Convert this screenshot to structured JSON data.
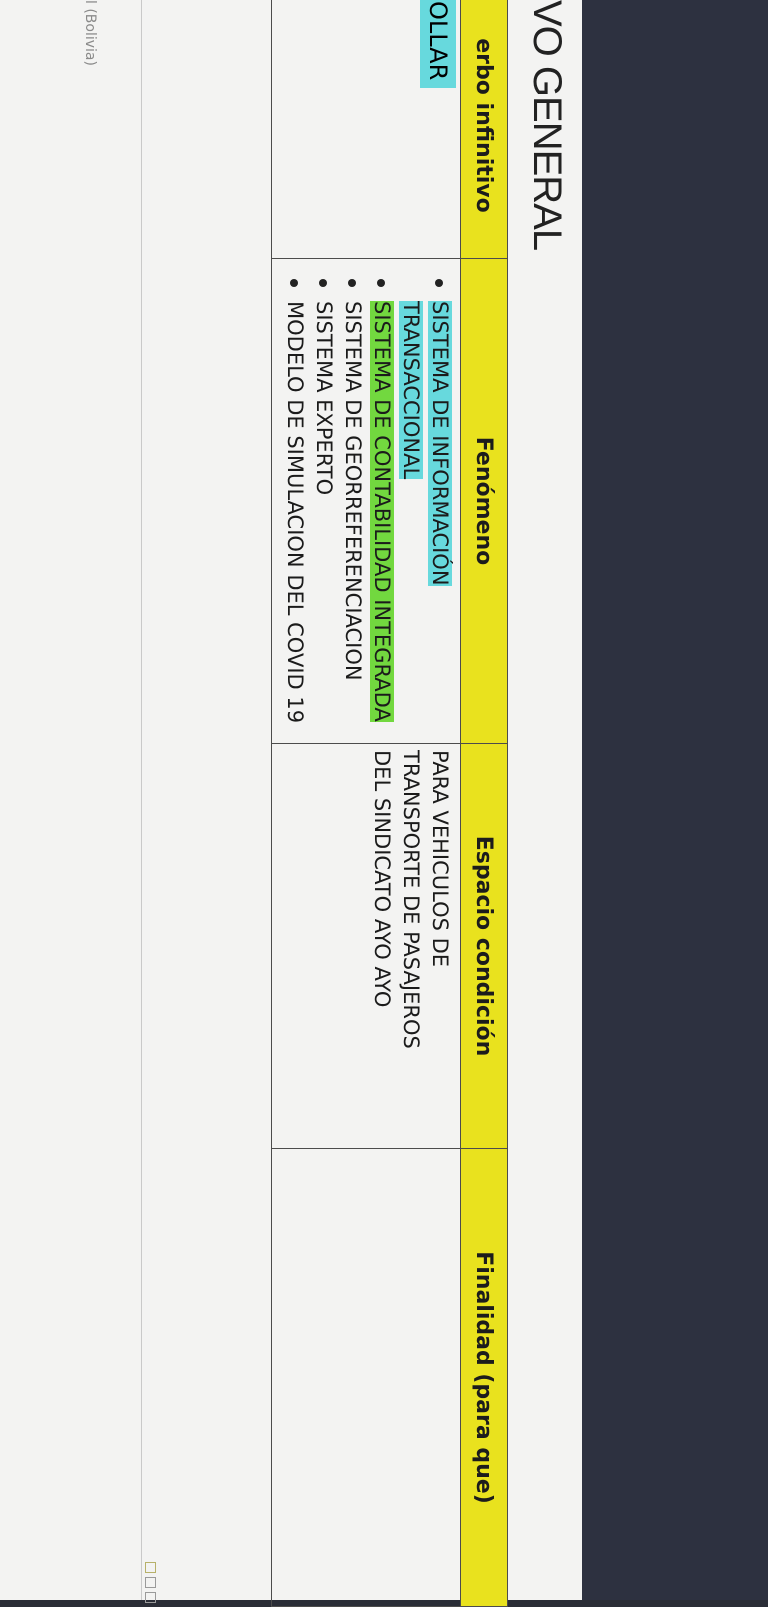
{
  "document": {
    "heading": "VO GENERAL",
    "status_language": "l (Bolivia)"
  },
  "table": {
    "headers": {
      "verbo": "erbo infinitivo",
      "fenomeno": "Fenómeno",
      "espacio": "Espacio condición",
      "finalidad": "Finalidad (para que)"
    },
    "row": {
      "verbo": "OLLAR",
      "fenomeno_items": [
        "SISTEMA DE INFORMACIÓN TRANSACCIONAL",
        "SISTEMA DE CONTABILIDAD INTEGRADA",
        "SISTEMA DE GEORREFERENCIACION",
        "SISTEMA EXPERTO",
        "MODELO DE SIMULACION DEL COVID 19"
      ],
      "espacio_lines": [
        "PARA VEHICULOS DE",
        "TRANSPORTE DE PASAJEROS",
        "DEL SINDICATO AYO AYO"
      ],
      "finalidad": ""
    }
  },
  "colors": {
    "header_fill": "#e9e21e",
    "highlight_cyan": "#67d9dd",
    "highlight_green": "#72d83f"
  },
  "icons": {
    "view_buttons": [
      "print-layout-icon",
      "read-mode-icon",
      "web-layout-icon"
    ]
  }
}
